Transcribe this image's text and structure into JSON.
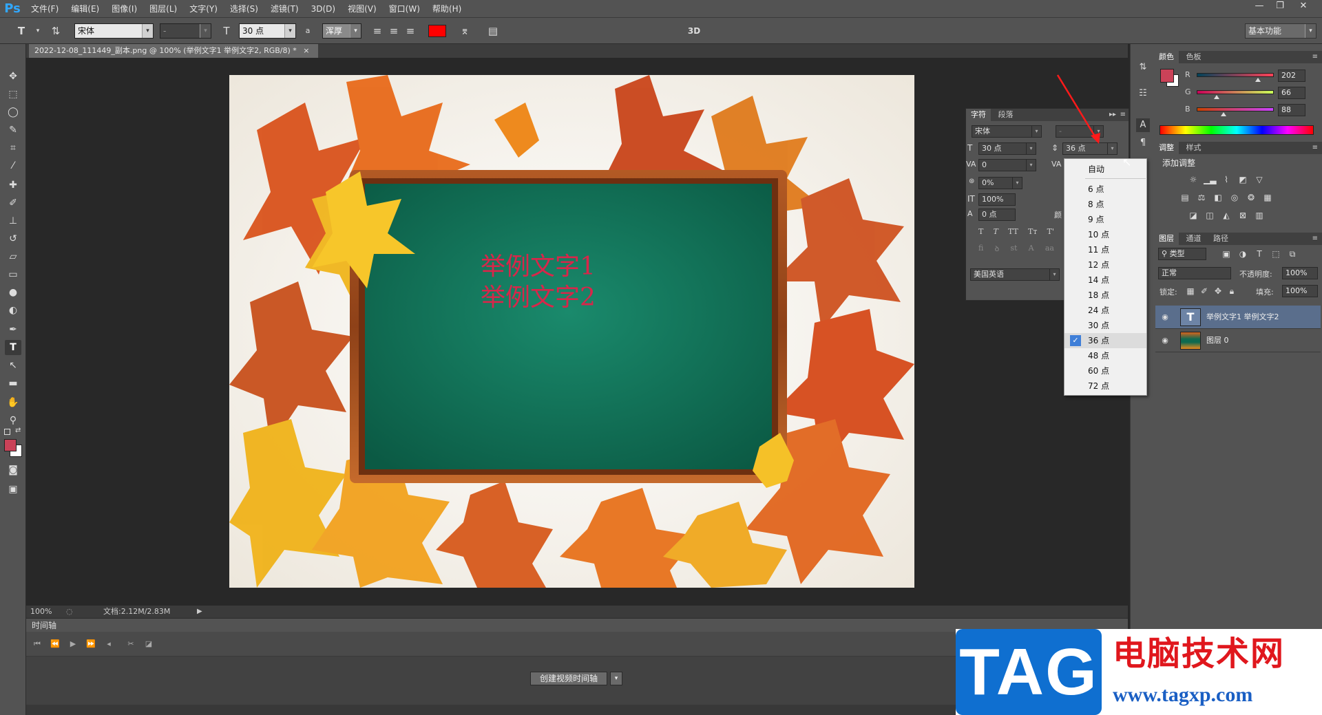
{
  "app": {
    "logo": "Ps"
  },
  "menu": [
    "文件(F)",
    "编辑(E)",
    "图像(I)",
    "图层(L)",
    "文字(Y)",
    "选择(S)",
    "滤镜(T)",
    "3D(D)",
    "视图(V)",
    "窗口(W)",
    "帮助(H)"
  ],
  "window_controls": {
    "minimize": "—",
    "restore": "❐",
    "close": "✕"
  },
  "options_bar": {
    "tool_icon": "T",
    "font_family": "宋体",
    "font_style": "-",
    "font_size": "30 点",
    "aa_label": "a",
    "aa_method": "浑厚",
    "text_color": "#ff0000",
    "mode_3d": "3D",
    "workspace": "基本功能"
  },
  "document": {
    "tab_title": "2022-12-08_111449_副本.png @ 100% (举例文字1 举例文字2, RGB/8) *",
    "tab_close": "×",
    "text_line1": "举例文字1",
    "text_line2": "举例文字2"
  },
  "status": {
    "zoom": "100%",
    "doc_info": "文档:2.12M/2.83M"
  },
  "timeline": {
    "title": "时间轴",
    "create_button": "创建视频时间轴"
  },
  "character_panel": {
    "tabs": [
      "字符",
      "段落"
    ],
    "font_family": "宋体",
    "font_style": "-",
    "font_size": "30 点",
    "leading": "36 点",
    "kerning": "0",
    "tracking_scale": "0%",
    "vertical_scale": "100%",
    "baseline_shift": "0 点",
    "color_label": "颜",
    "language": "美国英语",
    "style_buttons": [
      "T",
      "T",
      "TT",
      "Tт",
      "T'"
    ],
    "ligature_buttons": [
      "fi",
      "ꝺ",
      "st",
      "A",
      "aa"
    ]
  },
  "leading_dropdown": {
    "items": [
      "自动",
      "6 点",
      "8 点",
      "9 点",
      "10 点",
      "11 点",
      "12 点",
      "14 点",
      "18 点",
      "24 点",
      "30 点",
      "36 点",
      "48 点",
      "60 点",
      "72 点"
    ],
    "selected": "36 点"
  },
  "color_panel": {
    "tabs": [
      "颜色",
      "色板"
    ],
    "r_label": "R",
    "g_label": "G",
    "b_label": "B",
    "r": "202",
    "g": "66",
    "b": "88",
    "r_value": 202,
    "g_value": 66,
    "b_value": 88,
    "foreground": "#ca4258",
    "background": "#ffffff"
  },
  "adjustments_panel": {
    "tabs": [
      "调整",
      "样式"
    ],
    "title": "添加调整"
  },
  "layers_panel": {
    "tabs": [
      "图层",
      "通道",
      "路径"
    ],
    "filter": "类型",
    "blend_mode": "正常",
    "opacity_label": "不透明度:",
    "opacity": "100%",
    "lock_label": "锁定:",
    "fill_label": "填充:",
    "fill": "100%",
    "layers": [
      {
        "name": "举例文字1 举例文字2",
        "type": "T",
        "selected": true
      },
      {
        "name": "图层 0",
        "type": "image",
        "selected": false
      }
    ]
  },
  "watermark": {
    "tag": "TAG",
    "cn": "电脑技术网",
    "url": "www.tagxp.com"
  }
}
